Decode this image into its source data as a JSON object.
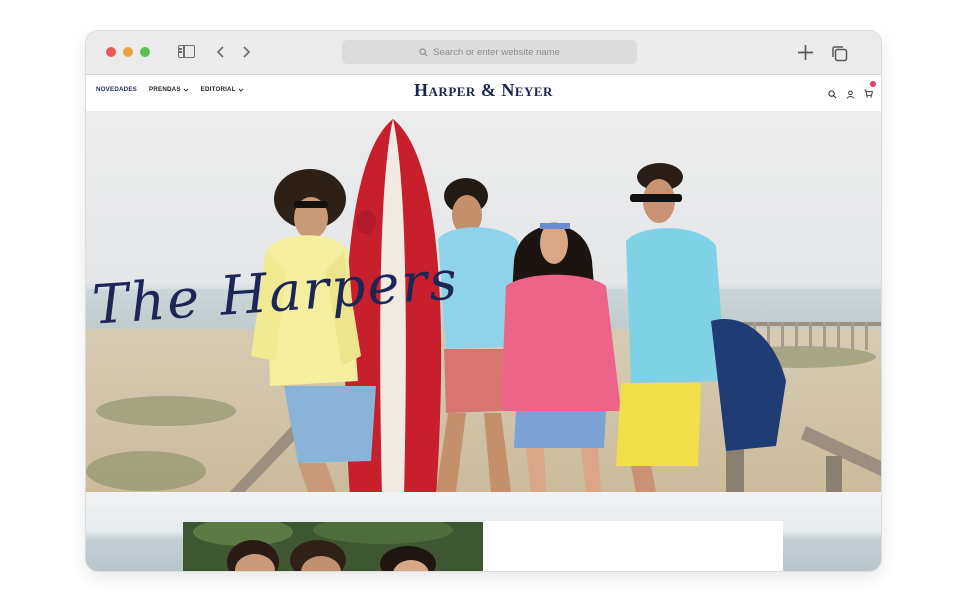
{
  "browser": {
    "address_placeholder": "Search or enter website name",
    "icons": [
      "sidebar-icon",
      "back-icon",
      "forward-icon",
      "search-icon",
      "new-tab-icon",
      "tabs-overview-icon"
    ]
  },
  "site": {
    "logo": "Harper & Neyer",
    "menu": [
      {
        "label": "NOVEDADES",
        "active": true
      },
      {
        "label": "PRENDAS",
        "has_dropdown": true
      },
      {
        "label": "EDITORIAL",
        "has_dropdown": true
      }
    ],
    "header_icons": [
      "search-icon",
      "account-icon",
      "cart-icon"
    ],
    "cart_count": ""
  },
  "hero": {
    "title": "The Harpers",
    "colors": {
      "accent": "#1d2757",
      "surfboard": "#c81f2c"
    }
  }
}
